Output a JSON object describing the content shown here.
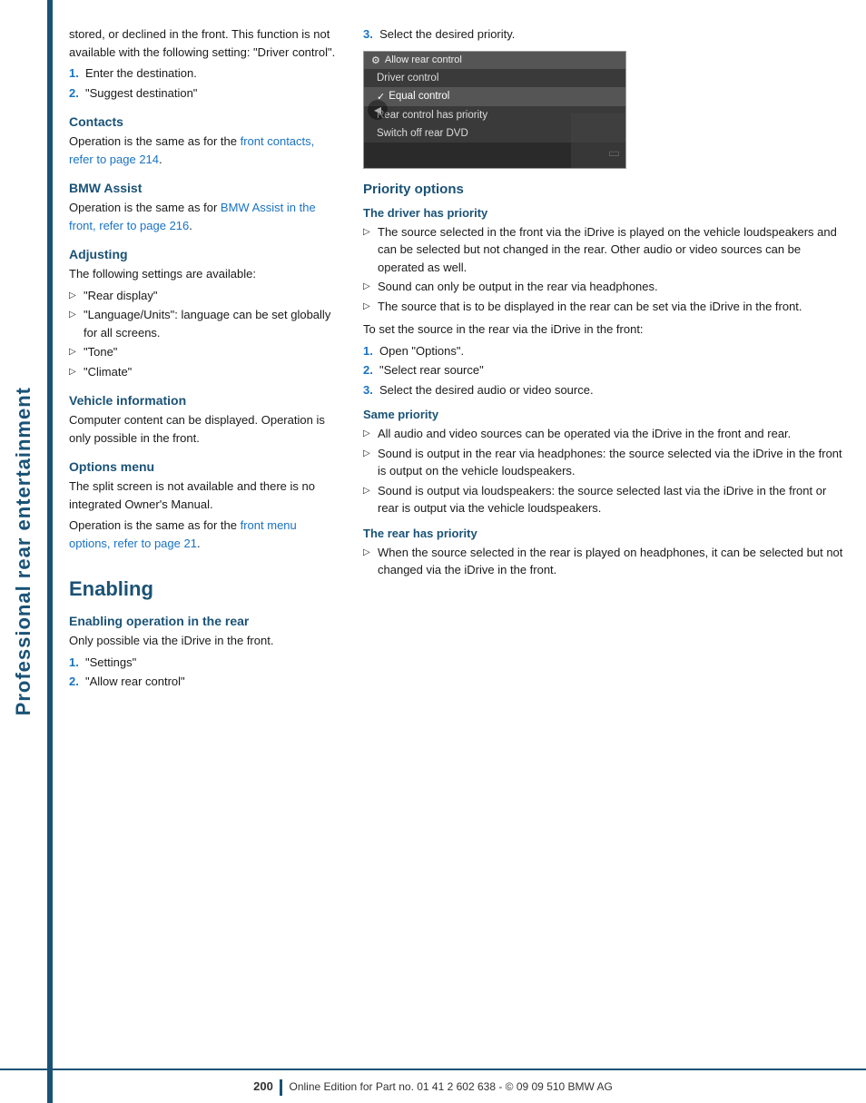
{
  "sidebar": {
    "text": "Professional rear entertainment"
  },
  "left_col": {
    "intro_text": "stored, or declined in the front. This function is not available with the following setting: \"Driver control\".",
    "steps_intro": [
      {
        "num": "1.",
        "text": "Enter the destination."
      },
      {
        "num": "2.",
        "text": "\"Suggest destination\""
      }
    ],
    "contacts": {
      "heading": "Contacts",
      "text": "Operation is the same as for the ",
      "link": "front contacts, refer to page 214",
      "text_after": "."
    },
    "bmw_assist": {
      "heading": "BMW Assist",
      "text": "Operation is the same as for ",
      "link": "BMW Assist in the front, refer to page 216",
      "text_after": "."
    },
    "adjusting": {
      "heading": "Adjusting",
      "text": "The following settings are available:",
      "items": [
        "\"Rear display\"",
        "\"Language/Units\": language can be set globally for all screens.",
        "\"Tone\"",
        "\"Climate\""
      ]
    },
    "vehicle_info": {
      "heading": "Vehicle information",
      "text": "Computer content can be displayed. Operation is only possible in the front."
    },
    "options_menu": {
      "heading": "Options menu",
      "text1": "The split screen is not available and there is no integrated Owner's Manual.",
      "text2": "Operation is the same as for the ",
      "link": "front menu options, refer to page 21",
      "text2_after": "."
    },
    "enabling": {
      "big_heading": "Enabling",
      "sub_heading": "Enabling operation in the rear",
      "text": "Only possible via the iDrive in the front.",
      "steps": [
        {
          "num": "1.",
          "text": "\"Settings\""
        },
        {
          "num": "2.",
          "text": "\"Allow rear control\""
        }
      ]
    }
  },
  "right_col": {
    "step3_label": "3.",
    "step3_text": "Select the desired priority.",
    "screenshot": {
      "topbar": "Allow rear control",
      "topbar_icon": "⚙",
      "menu_items": [
        {
          "label": "Driver control",
          "selected": false
        },
        {
          "label": "Equal control",
          "selected": true
        },
        {
          "label": "Rear control has priority",
          "selected": false
        },
        {
          "label": "Switch off rear DVD",
          "selected": false
        }
      ]
    },
    "priority_options": {
      "heading": "Priority options",
      "driver_priority": {
        "sub_heading": "The driver has priority",
        "items": [
          "The source selected in the front via the iDrive is played on the vehicle loudspeakers and can be selected but not changed in the rear. Other audio or video sources can be operated as well.",
          "Sound can only be output in the rear via headphones.",
          "The source that is to be displayed in the rear can be set via the iDrive in the front."
        ],
        "intro_text": "To set the source in the rear via the iDrive in the front:",
        "steps": [
          {
            "num": "1.",
            "text": "Open \"Options\"."
          },
          {
            "num": "2.",
            "text": "\"Select rear source\""
          },
          {
            "num": "3.",
            "text": "Select the desired audio or video source."
          }
        ]
      },
      "same_priority": {
        "sub_heading": "Same priority",
        "items": [
          "All audio and video sources can be operated via the iDrive in the front and rear.",
          "Sound is output in the rear via headphones: the source selected via the iDrive in the front is output on the vehicle loudspeakers.",
          "Sound is output via loudspeakers: the source selected last via the iDrive in the front or rear is output via the vehicle loudspeakers."
        ]
      },
      "rear_priority": {
        "sub_heading": "The rear has priority",
        "items": [
          "When the source selected in the rear is played on headphones, it can be selected but not changed via the iDrive in the front."
        ]
      }
    }
  },
  "footer": {
    "page_num": "200",
    "footer_text": "Online Edition for Part no. 01 41 2 602 638 - © 09 09 510 BMW AG"
  }
}
